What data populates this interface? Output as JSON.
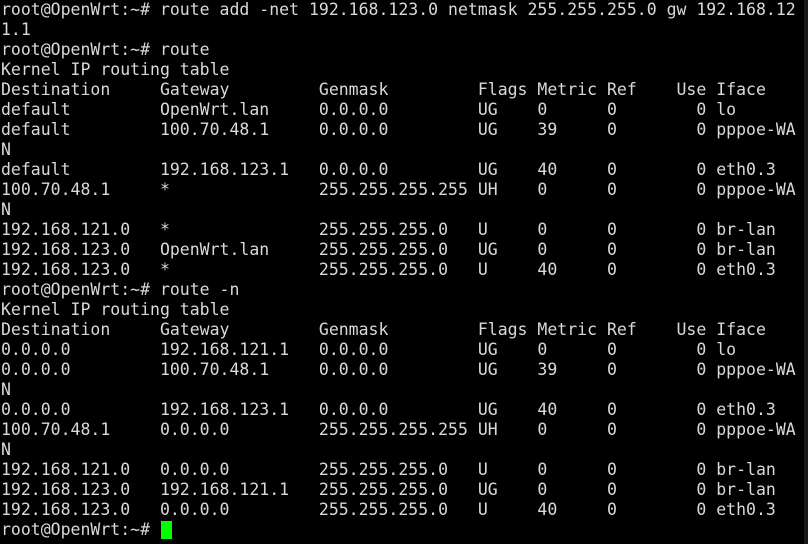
{
  "terminal": {
    "lines": [
      "root@OpenWrt:~# route add -net 192.168.123.0 netmask 255.255.255.0 gw 192.168.12",
      "1.1",
      "root@OpenWrt:~# route",
      "Kernel IP routing table",
      "Destination     Gateway         Genmask         Flags Metric Ref    Use Iface",
      "default         OpenWrt.lan     0.0.0.0         UG    0      0        0 lo",
      "default         100.70.48.1     0.0.0.0         UG    39     0        0 pppoe-WA",
      "N",
      "default         192.168.123.1   0.0.0.0         UG    40     0        0 eth0.3",
      "100.70.48.1     *               255.255.255.255 UH    0      0        0 pppoe-WA",
      "N",
      "192.168.121.0   *               255.255.255.0   U     0      0        0 br-lan",
      "192.168.123.0   OpenWrt.lan     255.255.255.0   UG    0      0        0 br-lan",
      "192.168.123.0   *               255.255.255.0   U     40     0        0 eth0.3",
      "root@OpenWrt:~# route -n",
      "Kernel IP routing table",
      "Destination     Gateway         Genmask         Flags Metric Ref    Use Iface",
      "0.0.0.0         192.168.121.1   0.0.0.0         UG    0      0        0 lo",
      "0.0.0.0         100.70.48.1     0.0.0.0         UG    39     0        0 pppoe-WA",
      "N",
      "0.0.0.0         192.168.123.1   0.0.0.0         UG    40     0        0 eth0.3",
      "100.70.48.1     0.0.0.0         255.255.255.255 UH    0      0        0 pppoe-WA",
      "N",
      "192.168.121.0   0.0.0.0         255.255.255.0   U     0      0        0 br-lan",
      "192.168.123.0   192.168.121.1   255.255.255.0   UG    0      0        0 br-lan",
      "192.168.123.0   0.0.0.0         255.255.255.0   U     40     0        0 eth0.3"
    ],
    "prompt": "root@OpenWrt:~# ",
    "colors": {
      "background": "#000000",
      "foreground": "#d9d9d9",
      "cursor": "#00ff00"
    }
  }
}
